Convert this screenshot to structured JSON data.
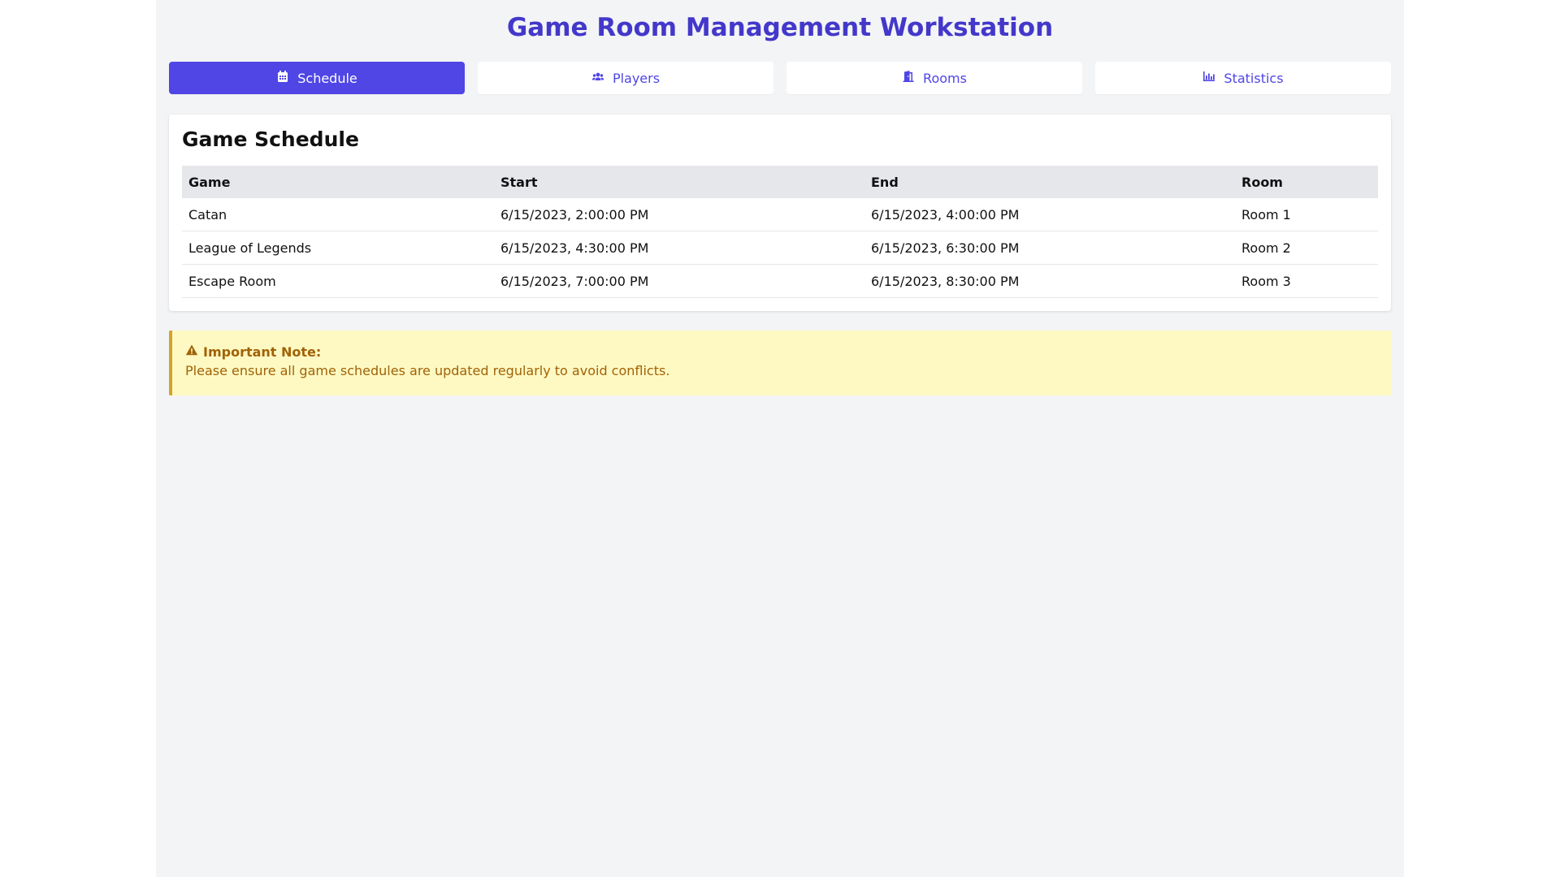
{
  "app": {
    "title": "Game Room Management Workstation"
  },
  "tabs": [
    {
      "label": "Schedule",
      "icon": "calendar-icon",
      "active": true
    },
    {
      "label": "Players",
      "icon": "users-icon",
      "active": false
    },
    {
      "label": "Rooms",
      "icon": "door-icon",
      "active": false
    },
    {
      "label": "Statistics",
      "icon": "bar-chart-icon",
      "active": false
    }
  ],
  "schedule": {
    "heading": "Game Schedule",
    "columns": [
      "Game",
      "Start",
      "End",
      "Room"
    ],
    "rows": [
      {
        "game": "Catan",
        "start": "6/15/2023, 2:00:00 PM",
        "end": "6/15/2023, 4:00:00 PM",
        "room": "Room 1"
      },
      {
        "game": "League of Legends",
        "start": "6/15/2023, 4:30:00 PM",
        "end": "6/15/2023, 6:30:00 PM",
        "room": "Room 2"
      },
      {
        "game": "Escape Room",
        "start": "6/15/2023, 7:00:00 PM",
        "end": "6/15/2023, 8:30:00 PM",
        "room": "Room 3"
      }
    ]
  },
  "note": {
    "icon": "warning-icon",
    "title": "Important Note:",
    "text": "Please ensure all game schedules are updated regularly to avoid conflicts."
  },
  "colors": {
    "accent": "#4f46e5",
    "title": "#4338ca",
    "note_bg": "#fef9c3",
    "note_text": "#a16207",
    "note_border": "#d4a12a"
  }
}
